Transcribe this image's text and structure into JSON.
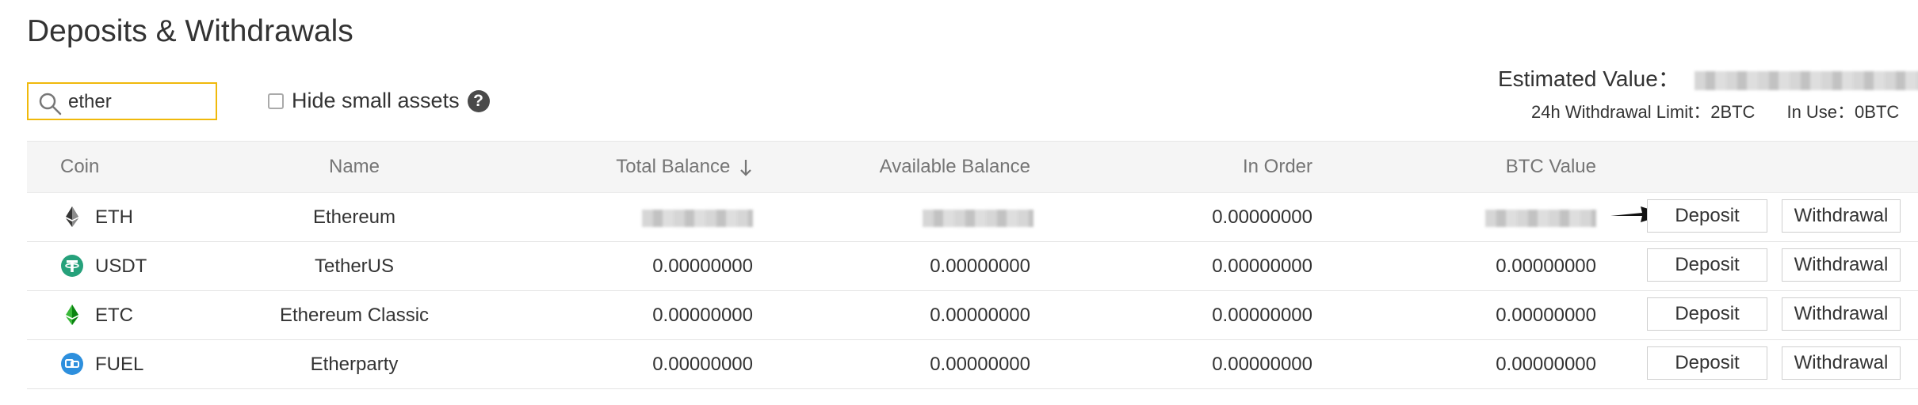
{
  "page": {
    "title": "Deposits & Withdrawals"
  },
  "search": {
    "value": "ether"
  },
  "filters": {
    "hide_small_label": "Hide small assets",
    "help_icon": "?"
  },
  "summary": {
    "estimated_label": "Estimated Value：",
    "limit_label": "24h Withdrawal Limit：",
    "limit_value": "2BTC",
    "in_use_label": "In Use：",
    "in_use_value": "0BTC"
  },
  "table": {
    "headers": {
      "coin": "Coin",
      "name": "Name",
      "total": "Total Balance",
      "available": "Available Balance",
      "in_order": "In Order",
      "btc_value": "BTC Value"
    },
    "rows": [
      {
        "symbol": "ETH",
        "name": "Ethereum",
        "total": "",
        "available": "",
        "in_order": "0.00000000",
        "btc": "",
        "icon": "eth-icon",
        "deposit": "Deposit",
        "withdrawal": "Withdrawal"
      },
      {
        "symbol": "USDT",
        "name": "TetherUS",
        "total": "0.00000000",
        "available": "0.00000000",
        "in_order": "0.00000000",
        "btc": "0.00000000",
        "icon": "usdt-icon",
        "deposit": "Deposit",
        "withdrawal": "Withdrawal"
      },
      {
        "symbol": "ETC",
        "name": "Ethereum Classic",
        "total": "0.00000000",
        "available": "0.00000000",
        "in_order": "0.00000000",
        "btc": "0.00000000",
        "icon": "etc-icon",
        "deposit": "Deposit",
        "withdrawal": "Withdrawal"
      },
      {
        "symbol": "FUEL",
        "name": "Etherparty",
        "total": "0.00000000",
        "available": "0.00000000",
        "in_order": "0.00000000",
        "btc": "0.00000000",
        "icon": "fuel-icon",
        "deposit": "Deposit",
        "withdrawal": "Withdrawal"
      }
    ]
  },
  "colors": {
    "accent": "#f0b90b",
    "usdt": "#26a17b",
    "fuel": "#2d8fdd",
    "etc": "#3ab83a"
  }
}
